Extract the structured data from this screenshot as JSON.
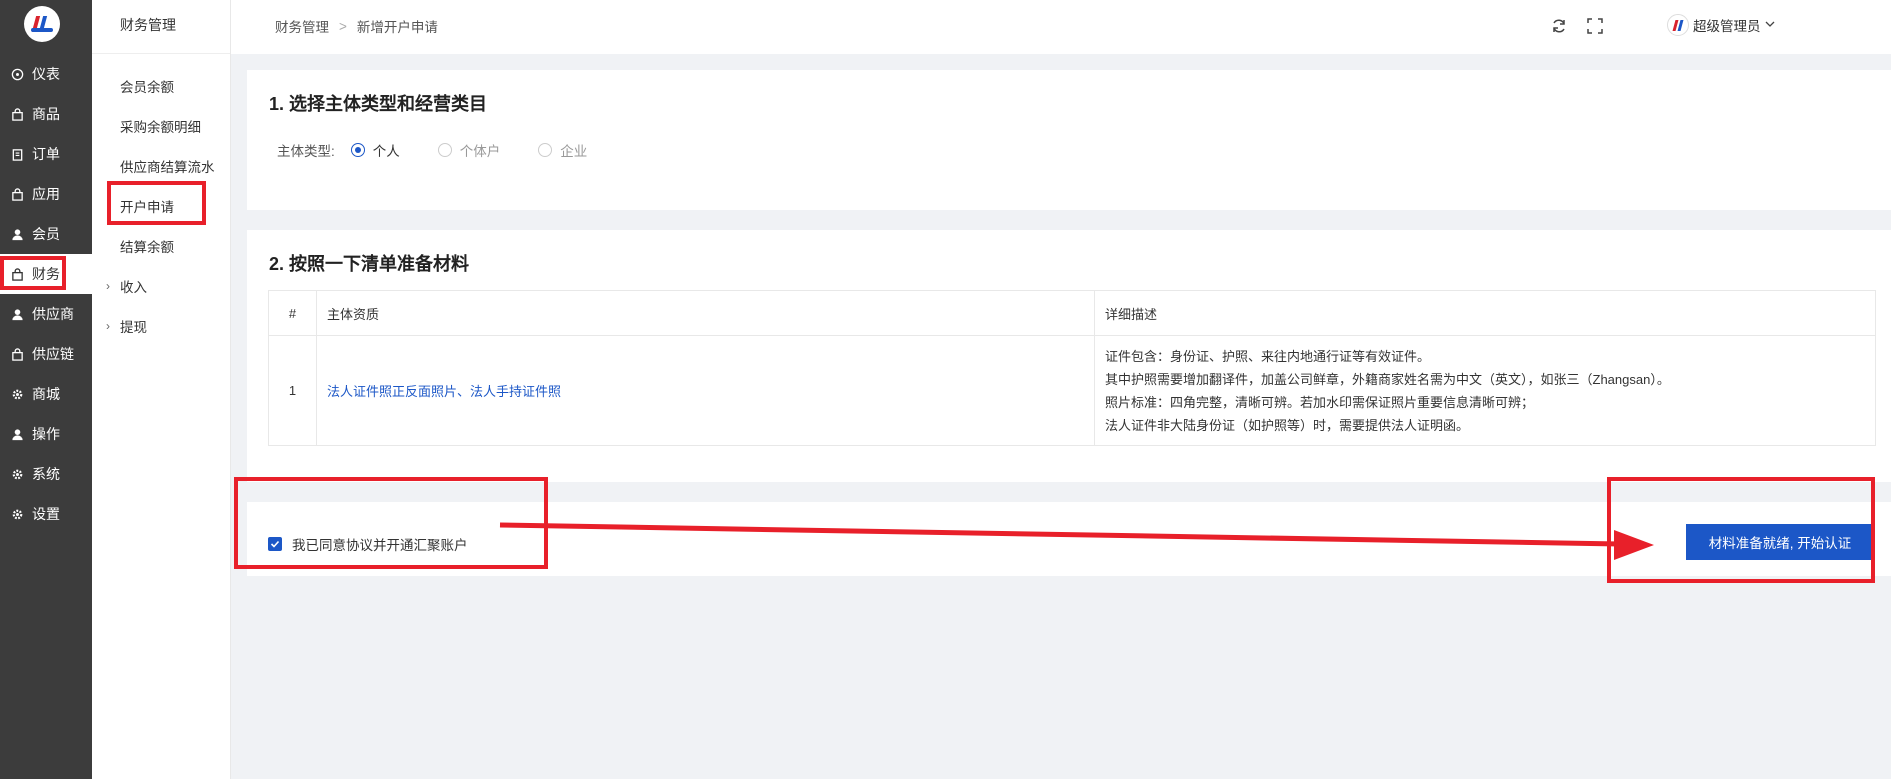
{
  "sidebar": {
    "items": [
      {
        "label": "仪表",
        "icon": "dashboard-icon"
      },
      {
        "label": "商品",
        "icon": "bag-icon"
      },
      {
        "label": "订单",
        "icon": "clipboard-icon"
      },
      {
        "label": "应用",
        "icon": "bag-icon"
      },
      {
        "label": "会员",
        "icon": "user-icon"
      },
      {
        "label": "财务",
        "icon": "bag-icon",
        "active": true
      },
      {
        "label": "供应商",
        "icon": "user-icon"
      },
      {
        "label": "供应链",
        "icon": "bag-icon"
      },
      {
        "label": "商城",
        "icon": "gear-icon"
      },
      {
        "label": "操作",
        "icon": "user-icon"
      },
      {
        "label": "系统",
        "icon": "gear-icon"
      },
      {
        "label": "设置",
        "icon": "gear-icon"
      }
    ]
  },
  "submenu": {
    "title": "财务管理",
    "items": [
      {
        "label": "会员余额"
      },
      {
        "label": "采购余额明细"
      },
      {
        "label": "供应商结算流水"
      },
      {
        "label": "开户申请",
        "active": true
      },
      {
        "label": "结算余额"
      },
      {
        "label": "收入",
        "expandable": true
      },
      {
        "label": "提现",
        "expandable": true
      }
    ]
  },
  "header": {
    "breadcrumb": [
      "财务管理",
      "新增开户申请"
    ],
    "user_name": "超级管理员"
  },
  "section1": {
    "title": "1. 选择主体类型和经营类目",
    "type_label": "主体类型:",
    "options": [
      {
        "label": "个人",
        "selected": true
      },
      {
        "label": "个体户",
        "selected": false
      },
      {
        "label": "企业",
        "selected": false
      }
    ]
  },
  "section2": {
    "title": "2. 按照一下清单准备材料",
    "columns": [
      "#",
      "主体资质",
      "详细描述"
    ],
    "rows": [
      {
        "index": "1",
        "qualification": "法人证件照正反面照片、法人手持证件照",
        "description": [
          "证件包含：身份证、护照、来往内地通行证等有效证件。",
          "其中护照需要增加翻译件，加盖公司鲜章，外籍商家姓名需为中文（英文），如张三（Zhangsan）。",
          "照片标准：四角完整，清晰可辨。若加水印需保证照片重要信息清晰可辨；",
          "法人证件非大陆身份证（如护照等）时，需要提供法人证明函。"
        ]
      }
    ]
  },
  "footer": {
    "agree_label": "我已同意协议并开通汇聚账户",
    "agree_checked": true,
    "start_button": "材料准备就绪, 开始认证"
  },
  "colors": {
    "sidebar_bg": "#3c3c3c",
    "accent": "#1c57c7",
    "annotation_red": "#e8202a"
  }
}
